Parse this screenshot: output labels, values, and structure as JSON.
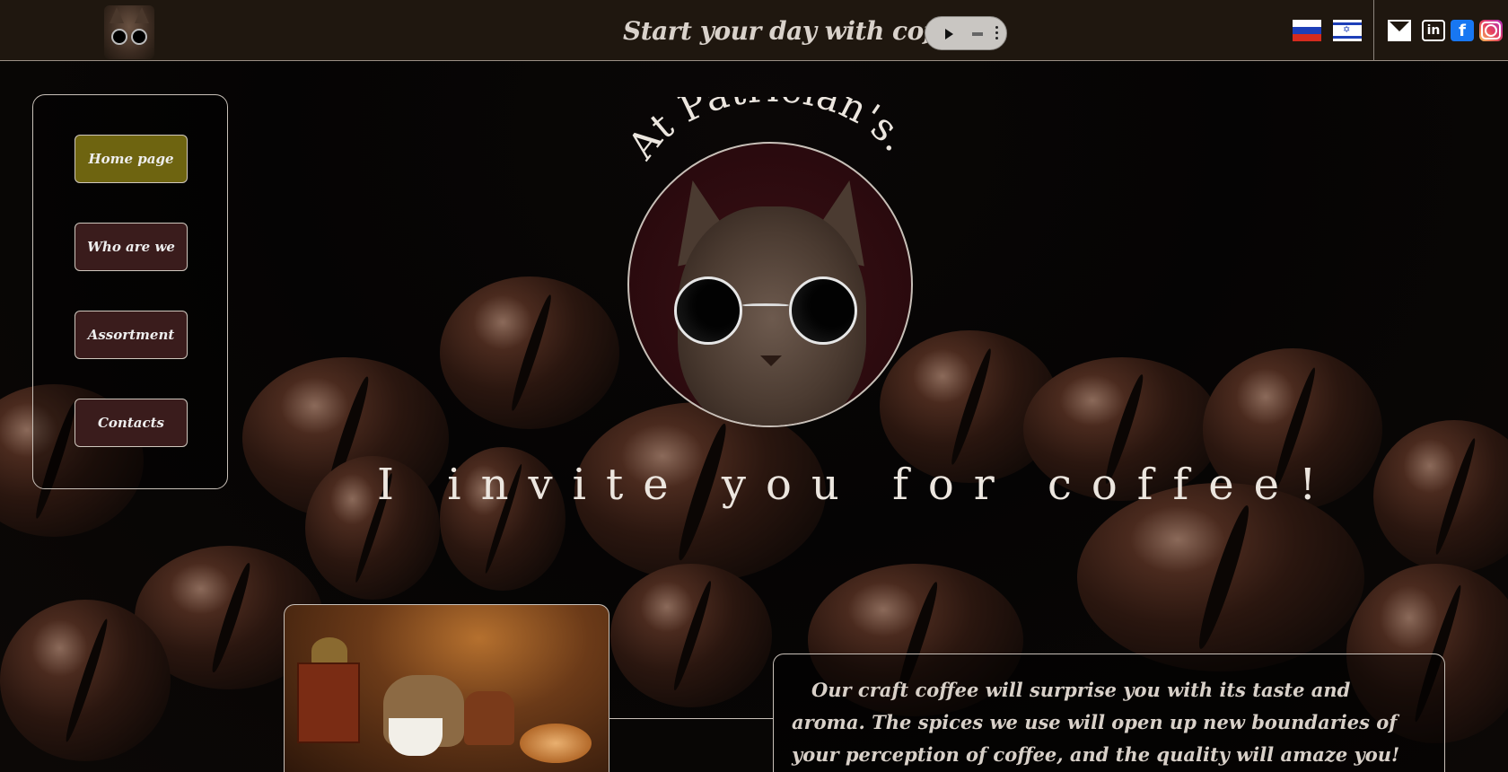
{
  "header": {
    "slogan": "Start your day with coffee!",
    "flags": [
      "russian-flag",
      "israel-flag"
    ],
    "social": [
      "mail-icon",
      "linkedin-icon",
      "facebook-icon",
      "instagram-icon"
    ],
    "linkedin_glyph": "in",
    "facebook_glyph": "f"
  },
  "nav": {
    "items": [
      {
        "label": "Home page",
        "active": true
      },
      {
        "label": "Who are we",
        "active": false
      },
      {
        "label": "Assortment",
        "active": false
      },
      {
        "label": "Contacts",
        "active": false
      }
    ]
  },
  "hero": {
    "arc_title": "At Patrician's.",
    "invite": "I invite you for coffee!"
  },
  "about": {
    "text": "Our craft coffee will surprise you with its taste and aroma. The spices we use will open up new boundaries of your perception of coffee, and the quality will amaze you!"
  },
  "colors": {
    "header_bg": "#1f170f",
    "nav_button": "#3a1c1c",
    "nav_active": "#6e6410",
    "text": "#ece6df"
  }
}
